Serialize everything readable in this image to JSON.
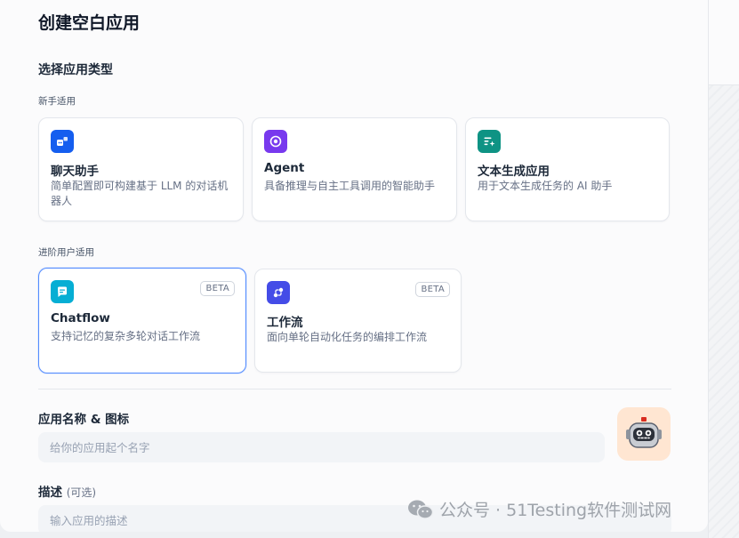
{
  "dialog": {
    "title": "创建空白应用",
    "section_title": "选择应用类型",
    "beginner_label": "新手适用",
    "advanced_label": "进阶用户适用"
  },
  "beginner_types": [
    {
      "name": "聊天助手",
      "desc": "简单配置即可构建基于 LLM 的对话机器人",
      "icon": "chat-bot-icon",
      "color": "#155eef"
    },
    {
      "name": "Agent",
      "desc": "具备推理与自主工具调用的智能助手",
      "icon": "agent-icon",
      "color": "#7839ee"
    },
    {
      "name": "文本生成应用",
      "desc": "用于文本生成任务的 AI 助手",
      "icon": "text-generation-icon",
      "color": "#0e9384"
    }
  ],
  "advanced_types": [
    {
      "name": "Chatflow",
      "desc": "支持记忆的复杂多轮对话工作流",
      "icon": "chatflow-icon",
      "color": "#06aed4",
      "badge": "BETA"
    },
    {
      "name": "工作流",
      "desc": "面向单轮自动化任务的编排工作流",
      "icon": "workflow-icon",
      "color": "#444ce7",
      "badge": "BETA"
    }
  ],
  "form": {
    "name_label": "应用名称 & 图标",
    "name_placeholder": "给你的应用起个名字",
    "desc_label": "描述",
    "desc_optional": "(可选)",
    "desc_placeholder": "输入应用的描述",
    "app_icon": "robot-emoji-icon",
    "app_icon_bg": "#ffe6d2"
  },
  "watermark": {
    "text": "公众号 · 51Testing软件测试网",
    "icon": "wechat-icon"
  }
}
